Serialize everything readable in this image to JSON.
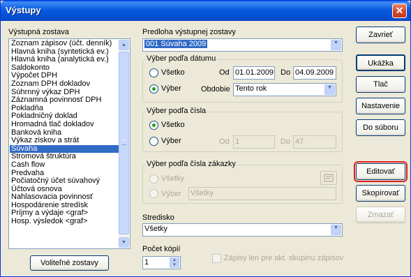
{
  "window": {
    "title": "Výstupy",
    "close_label": "✕"
  },
  "left": {
    "label": "Výstupná zostava",
    "items": [
      "Zoznam zápisov (účt. denník)",
      "Hlavná kniha (syntetická ev.)",
      "Hlavná kniha (analytická ev.)",
      "Saldokonto",
      "Výpočet DPH",
      "Zoznam DPH dokladov",
      "Súhrnný výkaz DPH",
      "Záznamná povinnosť DPH",
      "Pokladňa",
      "Pokladničný doklad",
      "Hromadná tlač dokladov",
      "Banková kniha",
      "Výkaz ziskov a strát",
      "Súvaha",
      "Stromová štruktúra",
      "Cash flow",
      "Predvaha",
      "Počiatočný účet súvahový",
      "Účtová osnova",
      "Nahlasovacia povinnosť",
      "Hospodárenie stredísk",
      "Príjmy a výdaje <graf>",
      "Hosp. výsledok <graf>"
    ],
    "selected_index": 13,
    "optional_button": "Voliteľné zostavy"
  },
  "template": {
    "label": "Predloha výstupnej zostavy",
    "value": "001 Súvaha 2009"
  },
  "date_group": {
    "title": "Výber podľa dátumu",
    "all_label": "Všetko",
    "select_label": "Výber",
    "from_label": "Od",
    "from_value": "01.01.2009",
    "to_label": "Do",
    "to_value": "04.09.2009",
    "period_label": "Obdobie",
    "period_value": "Tento rok"
  },
  "number_group": {
    "title": "Výber podľa čísla",
    "all_label": "Všetko",
    "select_label": "Výber",
    "from_label": "Od",
    "from_value": "1",
    "to_label": "Do",
    "to_value": "47"
  },
  "order_group": {
    "title": "Výber podľa čísla zákazky",
    "all_label": "Všetky",
    "select_label": "Výber",
    "select_value": "Všetky"
  },
  "center": {
    "label": "Stredisko",
    "value": "Všetky"
  },
  "copies": {
    "label": "Počet kópií",
    "value": "1"
  },
  "group_checkbox_label": "Zápisy len pre akt. skupinu zápisov",
  "buttons": {
    "close": "Zavrieť",
    "preview": "Ukážka",
    "print": "Tlač",
    "settings": "Nastavenie",
    "to_file": "Do súboru",
    "edit": "Editovať",
    "copy": "Skopírovať",
    "delete": "Zmazať"
  },
  "icons": {
    "close": "close-icon",
    "dropdown": "chevron-down-icon",
    "spin_up": "spin-up-icon",
    "spin_down": "spin-down-icon",
    "browse": "browse-icon"
  }
}
